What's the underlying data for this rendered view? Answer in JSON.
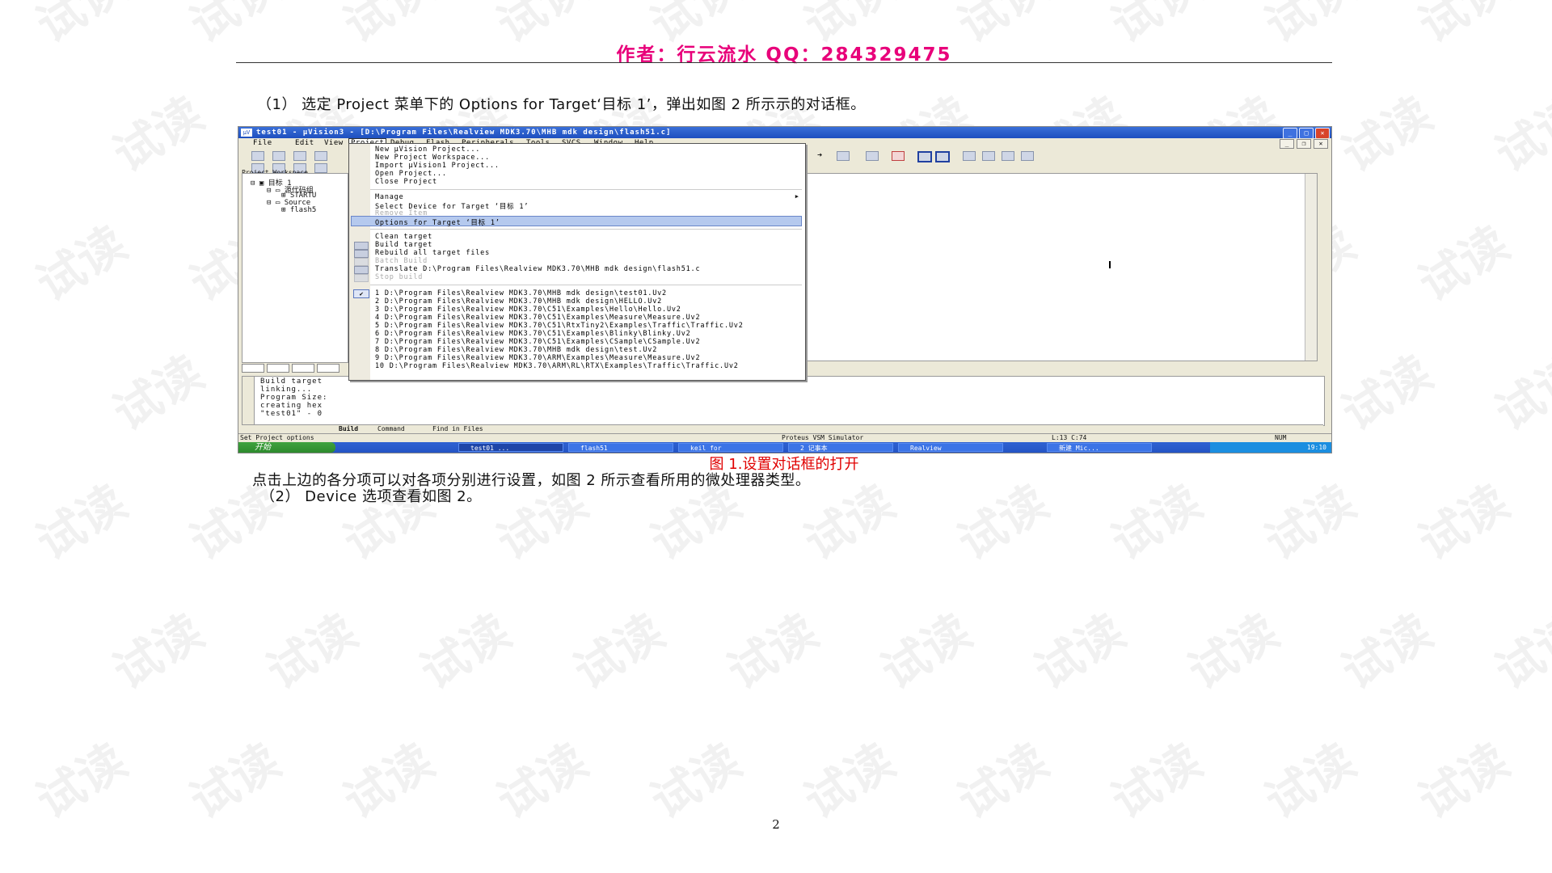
{
  "header": {
    "text": "作者：行云流水    QQ：284329475"
  },
  "paragraphs": {
    "p1": "（1） 选定 Project 菜单下的 Options for Target‘目标 1’，弹出如图 2 所示示的对话框。",
    "p2": "点击上边的各分项可以对各项分别进行设置，如图 2 所示查看所用的微处理器类型。",
    "p3": "（2） Device 选项查看如图 2。"
  },
  "caption": "图 1.设置对话框的打开",
  "page_number": "2",
  "watermark": "试读",
  "screenshot": {
    "title": "test01  - µVision3 - [D:\\Program Files\\Realview MDK3.70\\MHB mdk design\\flash51.c]",
    "menus": [
      "File",
      "Edit",
      "View",
      "Project",
      "Debug",
      "Flash",
      "Peripherals",
      "Tools",
      "SVCS",
      "Window",
      "Help"
    ],
    "workspace_title": "Project Workspace",
    "tree": [
      "目标 1",
      "源代码组",
      "STARTU",
      "Source",
      "flash5"
    ],
    "dropdown": {
      "items": [
        "New µVision Project...",
        "New Project Workspace...",
        "Import µVision1 Project...",
        "Open Project...",
        "Close Project",
        "Manage",
        "Select Device for Target ‘目标 1’",
        "Remove Item",
        "Options for Target ‘目标 1’",
        "Clean target",
        "Build target",
        "Rebuild all target files",
        "Batch Build",
        "Translate D:\\Program Files\\Realview MDK3.70\\MHB mdk design\\flash51.c",
        "Stop build"
      ],
      "recent": [
        "1 D:\\Program Files\\Realview MDK3.70\\MHB mdk design\\test01.Uv2",
        "2 D:\\Program Files\\Realview MDK3.70\\MHB mdk design\\HELLO.Uv2",
        "3 D:\\Program Files\\Realview MDK3.70\\C51\\Examples\\Hello\\Hello.Uv2",
        "4 D:\\Program Files\\Realview MDK3.70\\C51\\Examples\\Measure\\Measure.Uv2",
        "5 D:\\Program Files\\Realview MDK3.70\\C51\\RtxTiny2\\Examples\\Traffic\\Traffic.Uv2",
        "6 D:\\Program Files\\Realview MDK3.70\\C51\\Examples\\Blinky\\Blinky.Uv2",
        "7 D:\\Program Files\\Realview MDK3.70\\C51\\Examples\\CSample\\CSample.Uv2",
        "8 D:\\Program Files\\Realview MDK3.70\\MHB mdk design\\test.Uv2",
        "9 D:\\Program Files\\Realview MDK3.70\\ARM\\Examples\\Measure\\Measure.Uv2",
        "10 D:\\Program Files\\Realview MDK3.70\\ARM\\RL\\RTX\\Examples\\Traffic\\Traffic.Uv2"
      ]
    },
    "output": [
      "Build target",
      "linking...",
      "Program Size:",
      "creating hex",
      "\"test01\" - 0"
    ],
    "output_tabs": [
      "Build",
      "Command",
      "Find in Files"
    ],
    "status": {
      "left": "Set Project options",
      "sim": "Proteus VSM Simulator",
      "pos": "L:13 C:74",
      "mode": "NUM"
    },
    "taskbar": {
      "start": "开始",
      "tasks": [
        "test01 ...",
        "flash51",
        "keil for",
        "2 记事本",
        "Realview",
        "新建 Mic..."
      ],
      "clock": "19:10"
    }
  }
}
